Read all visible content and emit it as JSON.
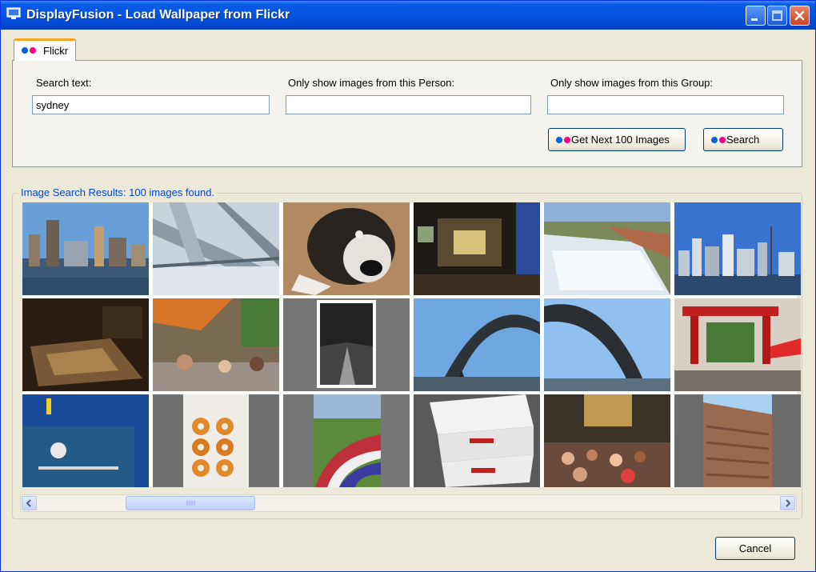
{
  "window": {
    "title": "DisplayFusion - Load Wallpaper from Flickr"
  },
  "tab": {
    "label": "Flickr"
  },
  "search": {
    "text_label": "Search text:",
    "text_value": "sydney",
    "person_label": "Only show images from this Person:",
    "person_value": "",
    "group_label": "Only show images from this Group:",
    "group_value": ""
  },
  "buttons": {
    "next_label": "Get Next 100 Images",
    "search_label": "Search",
    "cancel_label": "Cancel"
  },
  "results": {
    "label": "Image Search Results: 100 images found."
  },
  "scrollbar": {
    "position": 0.1
  },
  "colors": {
    "flickr_blue": "#0063dc",
    "flickr_pink": "#ff0084",
    "titlebar": "#0455e0",
    "group_label": "#0046d5"
  },
  "icons": {
    "app": "monitor-icon",
    "tab": "flickr-logo-icon",
    "scroll_left": "arrow-left-icon",
    "scroll_right": "arrow-right-icon"
  }
}
